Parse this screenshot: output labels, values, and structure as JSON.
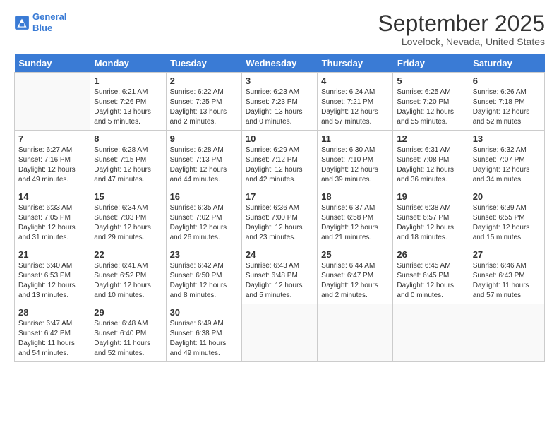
{
  "logo": {
    "line1": "General",
    "line2": "Blue"
  },
  "title": "September 2025",
  "location": "Lovelock, Nevada, United States",
  "weekdays": [
    "Sunday",
    "Monday",
    "Tuesday",
    "Wednesday",
    "Thursday",
    "Friday",
    "Saturday"
  ],
  "weeks": [
    [
      {
        "day": "",
        "info": ""
      },
      {
        "day": "1",
        "info": "Sunrise: 6:21 AM\nSunset: 7:26 PM\nDaylight: 13 hours\nand 5 minutes."
      },
      {
        "day": "2",
        "info": "Sunrise: 6:22 AM\nSunset: 7:25 PM\nDaylight: 13 hours\nand 2 minutes."
      },
      {
        "day": "3",
        "info": "Sunrise: 6:23 AM\nSunset: 7:23 PM\nDaylight: 13 hours\nand 0 minutes."
      },
      {
        "day": "4",
        "info": "Sunrise: 6:24 AM\nSunset: 7:21 PM\nDaylight: 12 hours\nand 57 minutes."
      },
      {
        "day": "5",
        "info": "Sunrise: 6:25 AM\nSunset: 7:20 PM\nDaylight: 12 hours\nand 55 minutes."
      },
      {
        "day": "6",
        "info": "Sunrise: 6:26 AM\nSunset: 7:18 PM\nDaylight: 12 hours\nand 52 minutes."
      }
    ],
    [
      {
        "day": "7",
        "info": "Sunrise: 6:27 AM\nSunset: 7:16 PM\nDaylight: 12 hours\nand 49 minutes."
      },
      {
        "day": "8",
        "info": "Sunrise: 6:28 AM\nSunset: 7:15 PM\nDaylight: 12 hours\nand 47 minutes."
      },
      {
        "day": "9",
        "info": "Sunrise: 6:28 AM\nSunset: 7:13 PM\nDaylight: 12 hours\nand 44 minutes."
      },
      {
        "day": "10",
        "info": "Sunrise: 6:29 AM\nSunset: 7:12 PM\nDaylight: 12 hours\nand 42 minutes."
      },
      {
        "day": "11",
        "info": "Sunrise: 6:30 AM\nSunset: 7:10 PM\nDaylight: 12 hours\nand 39 minutes."
      },
      {
        "day": "12",
        "info": "Sunrise: 6:31 AM\nSunset: 7:08 PM\nDaylight: 12 hours\nand 36 minutes."
      },
      {
        "day": "13",
        "info": "Sunrise: 6:32 AM\nSunset: 7:07 PM\nDaylight: 12 hours\nand 34 minutes."
      }
    ],
    [
      {
        "day": "14",
        "info": "Sunrise: 6:33 AM\nSunset: 7:05 PM\nDaylight: 12 hours\nand 31 minutes."
      },
      {
        "day": "15",
        "info": "Sunrise: 6:34 AM\nSunset: 7:03 PM\nDaylight: 12 hours\nand 29 minutes."
      },
      {
        "day": "16",
        "info": "Sunrise: 6:35 AM\nSunset: 7:02 PM\nDaylight: 12 hours\nand 26 minutes."
      },
      {
        "day": "17",
        "info": "Sunrise: 6:36 AM\nSunset: 7:00 PM\nDaylight: 12 hours\nand 23 minutes."
      },
      {
        "day": "18",
        "info": "Sunrise: 6:37 AM\nSunset: 6:58 PM\nDaylight: 12 hours\nand 21 minutes."
      },
      {
        "day": "19",
        "info": "Sunrise: 6:38 AM\nSunset: 6:57 PM\nDaylight: 12 hours\nand 18 minutes."
      },
      {
        "day": "20",
        "info": "Sunrise: 6:39 AM\nSunset: 6:55 PM\nDaylight: 12 hours\nand 15 minutes."
      }
    ],
    [
      {
        "day": "21",
        "info": "Sunrise: 6:40 AM\nSunset: 6:53 PM\nDaylight: 12 hours\nand 13 minutes."
      },
      {
        "day": "22",
        "info": "Sunrise: 6:41 AM\nSunset: 6:52 PM\nDaylight: 12 hours\nand 10 minutes."
      },
      {
        "day": "23",
        "info": "Sunrise: 6:42 AM\nSunset: 6:50 PM\nDaylight: 12 hours\nand 8 minutes."
      },
      {
        "day": "24",
        "info": "Sunrise: 6:43 AM\nSunset: 6:48 PM\nDaylight: 12 hours\nand 5 minutes."
      },
      {
        "day": "25",
        "info": "Sunrise: 6:44 AM\nSunset: 6:47 PM\nDaylight: 12 hours\nand 2 minutes."
      },
      {
        "day": "26",
        "info": "Sunrise: 6:45 AM\nSunset: 6:45 PM\nDaylight: 12 hours\nand 0 minutes."
      },
      {
        "day": "27",
        "info": "Sunrise: 6:46 AM\nSunset: 6:43 PM\nDaylight: 11 hours\nand 57 minutes."
      }
    ],
    [
      {
        "day": "28",
        "info": "Sunrise: 6:47 AM\nSunset: 6:42 PM\nDaylight: 11 hours\nand 54 minutes."
      },
      {
        "day": "29",
        "info": "Sunrise: 6:48 AM\nSunset: 6:40 PM\nDaylight: 11 hours\nand 52 minutes."
      },
      {
        "day": "30",
        "info": "Sunrise: 6:49 AM\nSunset: 6:38 PM\nDaylight: 11 hours\nand 49 minutes."
      },
      {
        "day": "",
        "info": ""
      },
      {
        "day": "",
        "info": ""
      },
      {
        "day": "",
        "info": ""
      },
      {
        "day": "",
        "info": ""
      }
    ]
  ]
}
